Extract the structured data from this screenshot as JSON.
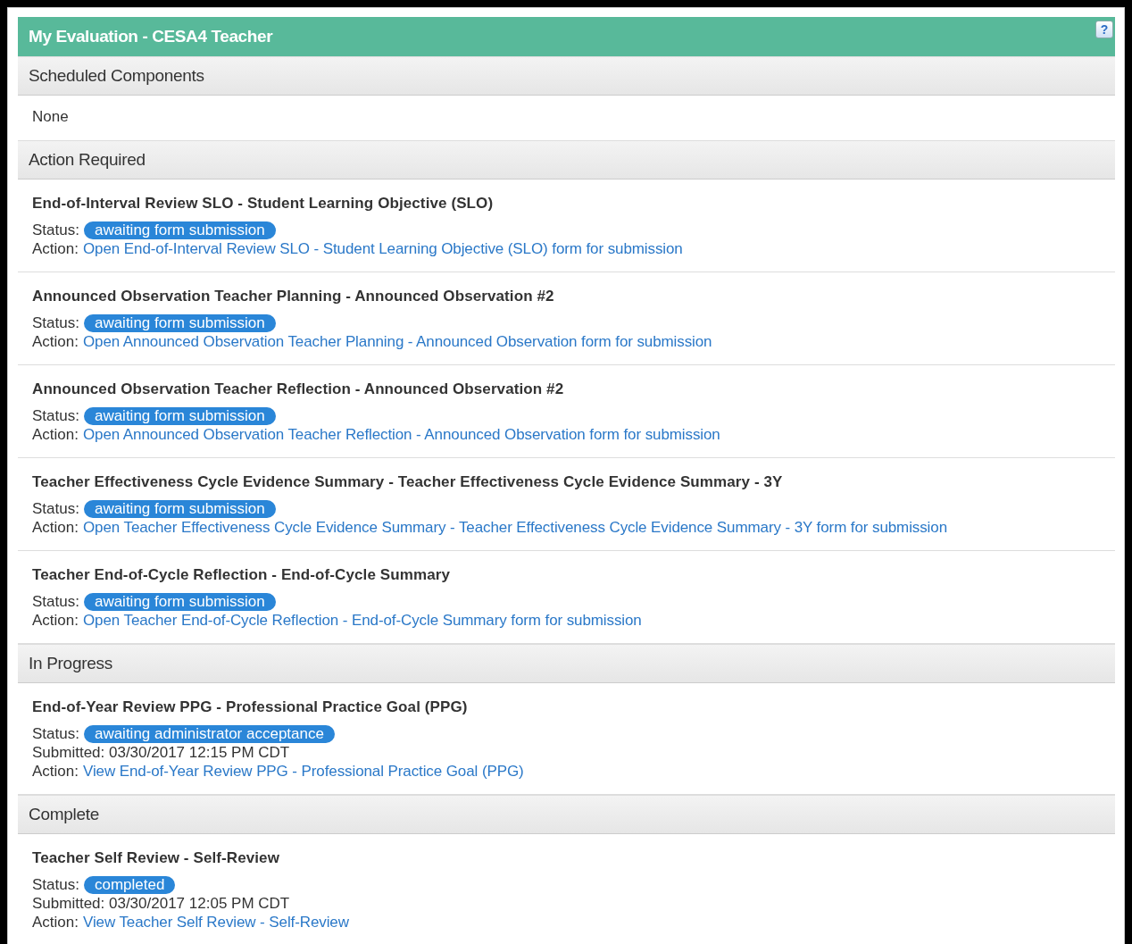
{
  "panel": {
    "title": "My Evaluation - CESA4 Teacher",
    "help_label": "?"
  },
  "sections": [
    {
      "heading": "Scheduled Components",
      "empty_text": "None"
    },
    {
      "heading": "Action Required",
      "items": [
        {
          "title": "End-of-Interval Review SLO - Student Learning Objective (SLO)",
          "status_label": "Status:",
          "status": "awaiting form submission",
          "action_label": "Action:",
          "action": "Open End-of-Interval Review SLO - Student Learning Objective (SLO) form for submission"
        },
        {
          "title": "Announced Observation Teacher Planning - Announced Observation #2",
          "status_label": "Status:",
          "status": "awaiting form submission",
          "action_label": "Action:",
          "action": "Open Announced Observation Teacher Planning - Announced Observation form for submission"
        },
        {
          "title": "Announced Observation Teacher Reflection - Announced Observation #2",
          "status_label": "Status:",
          "status": "awaiting form submission",
          "action_label": "Action:",
          "action": "Open Announced Observation Teacher Reflection - Announced Observation form for submission"
        },
        {
          "title": "Teacher Effectiveness Cycle Evidence Summary - Teacher Effectiveness Cycle Evidence Summary - 3Y",
          "status_label": "Status:",
          "status": "awaiting form submission",
          "action_label": "Action:",
          "action": "Open Teacher Effectiveness Cycle Evidence Summary - Teacher Effectiveness Cycle Evidence Summary - 3Y form for submission"
        },
        {
          "title": "Teacher End-of-Cycle Reflection - End-of-Cycle Summary",
          "status_label": "Status:",
          "status": "awaiting form submission",
          "action_label": "Action:",
          "action": "Open Teacher End-of-Cycle Reflection - End-of-Cycle Summary form for submission"
        }
      ]
    },
    {
      "heading": "In Progress",
      "items": [
        {
          "title": "End-of-Year Review PPG - Professional Practice Goal (PPG)",
          "status_label": "Status:",
          "status": "awaiting administrator acceptance",
          "submitted": "Submitted: 03/30/2017 12:15 PM CDT",
          "action_label": "Action:",
          "action": "View End-of-Year Review PPG - Professional Practice Goal (PPG)"
        }
      ]
    },
    {
      "heading": "Complete",
      "items": [
        {
          "title": "Teacher Self Review - Self-Review",
          "status_label": "Status:",
          "status": "completed",
          "submitted": "Submitted: 03/30/2017 12:05 PM CDT",
          "action_label": "Action:",
          "action": "View Teacher Self Review - Self-Review"
        }
      ]
    }
  ]
}
